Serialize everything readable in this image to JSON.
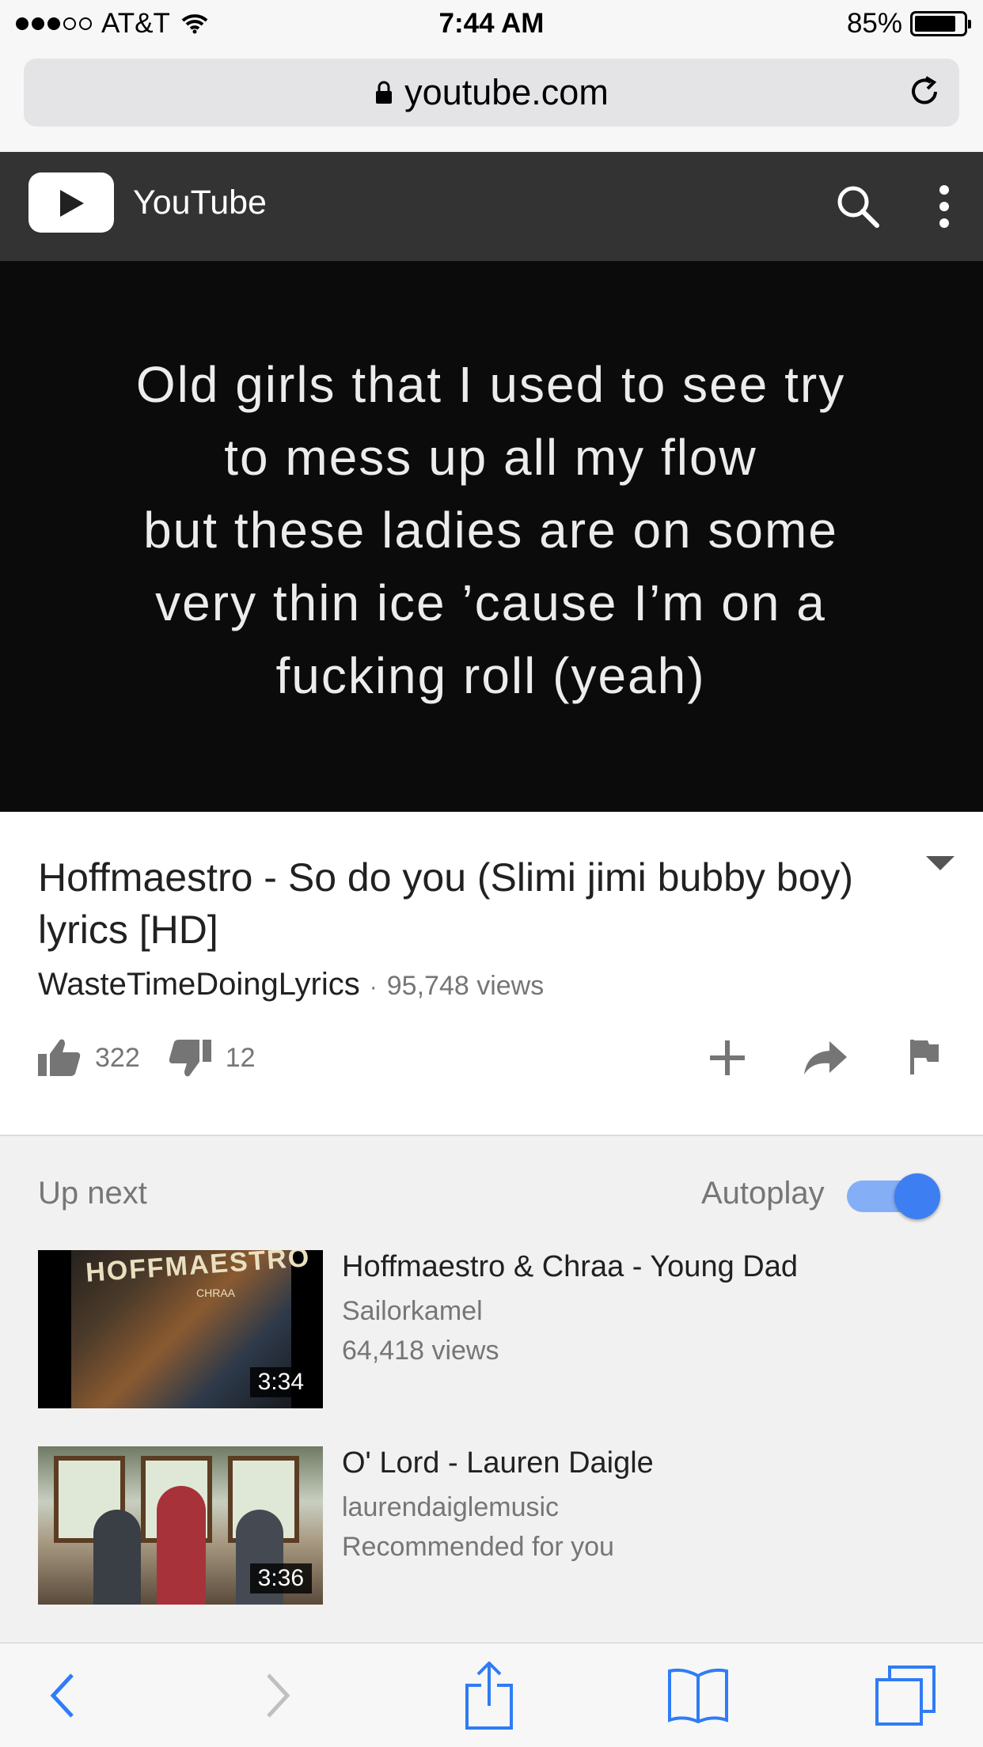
{
  "status_bar": {
    "carrier": "AT&T",
    "time": "7:44 AM",
    "battery_percent": "85%",
    "battery_level": 0.85,
    "signal_bars": 3
  },
  "browser": {
    "url": "youtube.com"
  },
  "header": {
    "title": "YouTube",
    "icons": [
      "youtube-logo-icon",
      "search-icon",
      "more-vert-icon"
    ]
  },
  "video": {
    "lyrics_lines": [
      "Old girls that I used to see try",
      "to mess up all my flow",
      "but these ladies are on some",
      "very thin ice ’cause I’m on a",
      "fucking roll (yeah)"
    ],
    "title": "Hoffmaestro - So do you (Slimi jimi bubby boy) lyrics [HD]",
    "channel": "WasteTimeDoingLyrics",
    "separator": "·",
    "views": "95,748 views",
    "likes": "322",
    "dislikes": "12"
  },
  "up_next": {
    "label": "Up next",
    "autoplay_label": "Autoplay",
    "autoplay_on": true,
    "items": [
      {
        "title": "Hoffmaestro & Chraa - Young Dad",
        "channel": "Sailorkamel",
        "info": "64,418 views",
        "duration": "3:34",
        "thumb_text": "HOFFMAESTRO",
        "thumb_subtext": "CHRAA"
      },
      {
        "title": "O' Lord - Lauren Daigle",
        "channel": "laurendaiglemusic",
        "info": "Recommended for you",
        "duration": "3:36"
      }
    ]
  },
  "colors": {
    "header_bg": "#333333",
    "accent": "#3d7ef3",
    "ios_blue": "#2f7cf6"
  }
}
